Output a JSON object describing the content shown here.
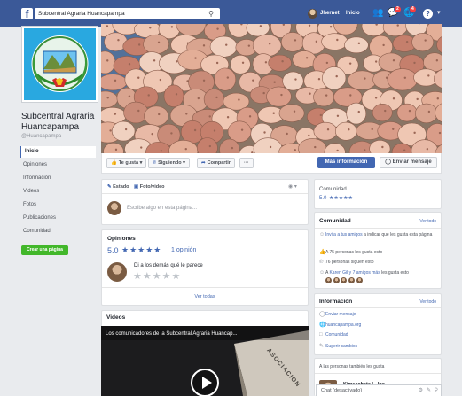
{
  "topbar": {
    "logo": "f",
    "search_value": "Subcentral Agraria Huancapampa",
    "user_name": "Jhernet",
    "home_label": "Inicio",
    "friends_icon": "friends-icon",
    "messages_badge": "2",
    "notifications_badge": "4",
    "help_icon": "help-icon"
  },
  "page": {
    "name": "Subcentral Agraria Huancapampa",
    "handle": "@Huancapampa"
  },
  "sidebar": {
    "items": [
      {
        "label": "Inicio"
      },
      {
        "label": "Opiniones"
      },
      {
        "label": "Información"
      },
      {
        "label": "Videos"
      },
      {
        "label": "Fotos"
      },
      {
        "label": "Publicaciones"
      },
      {
        "label": "Comunidad"
      }
    ],
    "create_page": "Crear una página"
  },
  "actions": {
    "like": "Te gusta",
    "follow": "Siguiendo",
    "share": "Compartir",
    "more": "···",
    "info": "Más información",
    "message": "Enviar mensaje"
  },
  "composer": {
    "state": "Estado",
    "photo": "Foto/video",
    "placeholder": "Escribe algo en esta página..."
  },
  "reviews": {
    "title": "Opiniones",
    "rating": "5.0",
    "count": "1 opinión",
    "prompt": "Di a los demás qué le parece",
    "see_all": "Ver todas"
  },
  "videos": {
    "title": "Videos",
    "video_title": "Los comunicadores de la Subcentral Agraria Huancap...",
    "sign_text": "ASOCIACION"
  },
  "community_rating": {
    "label": "Comunidad",
    "value": "5.0"
  },
  "community": {
    "title": "Comunidad",
    "see_all": "Ver todo",
    "invite_link": "Invita a tus amigos",
    "invite_rest": " a indicar que les gusta esta página",
    "likes": "A 75 personas les gusta esto",
    "follows": "76 personas siguen esto",
    "friends_prefix": "A ",
    "friends_link": "Karen Gil y 7 amigos más",
    "friends_rest": " les gusta esto"
  },
  "info": {
    "title": "Información",
    "see_all": "Ver todo",
    "send_message": "Enviar mensaje",
    "email": "huancapampa.org",
    "category": "Comunidad",
    "suggest": "Sugerir cambios"
  },
  "related": {
    "title": "A las personas también les gusta",
    "first_item": "Kimsachata I - Inc"
  },
  "chat": {
    "label": "Chat (desactivado)"
  },
  "colors": {
    "brand": "#3b5998",
    "accent": "#4267b2",
    "success": "#42b72a",
    "background": "#e9ebee"
  }
}
